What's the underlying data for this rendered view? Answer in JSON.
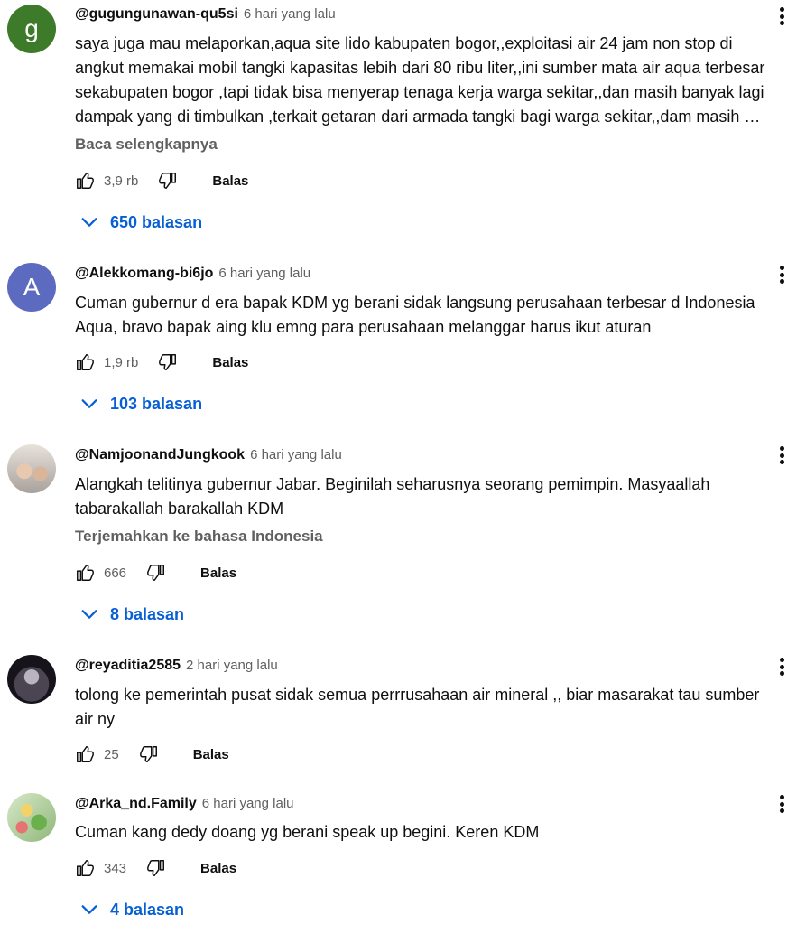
{
  "comments": [
    {
      "author": "@gugungunawan-qu5si",
      "time": "6 hari yang lalu",
      "avatar_letter": "g",
      "lines": [
        "saya juga mau melaporkan,aqua site lido kabupaten bogor,,exploitasi air 24 jam non stop di",
        "angkut memakai mobil tangki kapasitas lebih dari 80 ribu liter,,ini sumber mata air aqua terbesar",
        "sekabupaten bogor ,tapi tidak bisa menyerap tenaga kerja warga sekitar,,dan masih banyak lagi",
        "dampak yang di timbulkan ,terkait getaran dari armada tangki bagi warga sekitar,,dam masih …"
      ],
      "more_label": "Baca selengkapnya",
      "likes": "3,9 rb",
      "reply_label": "Balas",
      "replies_label": "650 balasan"
    },
    {
      "author": "@Alekkomang-bi6jo",
      "time": "6 hari yang lalu",
      "avatar_letter": "A",
      "lines": [
        "Cuman gubernur d era bapak KDM yg berani sidak langsung perusahaan terbesar d Indonesia",
        "Aqua, bravo bapak aing klu emng para perusahaan melanggar harus ikut aturan"
      ],
      "likes": "1,9 rb",
      "reply_label": "Balas",
      "replies_label": "103 balasan"
    },
    {
      "author": "@NamjoonandJungkook",
      "time": "6 hari yang lalu",
      "lines": [
        "Alangkah telitinya gubernur Jabar. Beginilah seharusnya seorang pemimpin. Masyaallah",
        "tabarakallah barakallah KDM"
      ],
      "more_label": "Terjemahkan ke bahasa Indonesia",
      "likes": "666",
      "reply_label": "Balas",
      "replies_label": "8 balasan"
    },
    {
      "author": "@reyaditia2585",
      "time": "2 hari yang lalu",
      "lines": [
        "tolong ke pemerintah pusat sidak semua perrrusahaan air mineral ,, biar masarakat tau sumber",
        "air ny"
      ],
      "likes": "25",
      "reply_label": "Balas"
    },
    {
      "author": "@Arka_nd.Family",
      "time": "6 hari yang lalu",
      "lines": [
        "Cuman kang dedy doang yg berani speak up begini. Keren KDM"
      ],
      "likes": "343",
      "reply_label": "Balas",
      "replies_label": "4 balasan"
    }
  ],
  "icons": {
    "like": "thumb-up-icon",
    "dislike": "thumb-down-icon",
    "expand": "chevron-down-icon",
    "menu": "more-vert-icon"
  },
  "colors": {
    "link_blue": "#065fd4",
    "muted": "#606060"
  }
}
